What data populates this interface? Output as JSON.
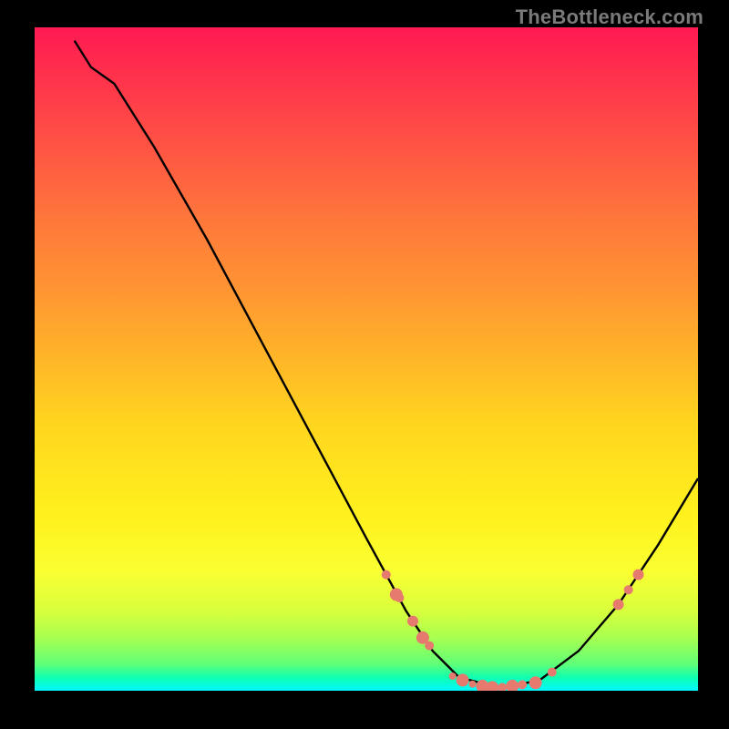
{
  "watermark": "TheBottleneck.com",
  "chart_data": {
    "type": "line",
    "title": "",
    "xlabel": "",
    "ylabel": "",
    "xlim": [
      0,
      100
    ],
    "ylim": [
      0,
      100
    ],
    "curve": {
      "name": "bottleneck-curve",
      "color": "#000000",
      "points": [
        {
          "x": 6.0,
          "y": 98.0
        },
        {
          "x": 8.5,
          "y": 94.0
        },
        {
          "x": 12.0,
          "y": 91.5
        },
        {
          "x": 18.0,
          "y": 82.0
        },
        {
          "x": 26.0,
          "y": 68.0
        },
        {
          "x": 34.0,
          "y": 53.0
        },
        {
          "x": 42.0,
          "y": 38.0
        },
        {
          "x": 50.0,
          "y": 23.0
        },
        {
          "x": 56.0,
          "y": 12.0
        },
        {
          "x": 60.0,
          "y": 6.0
        },
        {
          "x": 64.0,
          "y": 2.0
        },
        {
          "x": 70.0,
          "y": 0.5
        },
        {
          "x": 76.0,
          "y": 1.5
        },
        {
          "x": 82.0,
          "y": 6.0
        },
        {
          "x": 88.0,
          "y": 13.0
        },
        {
          "x": 94.0,
          "y": 22.0
        },
        {
          "x": 100.0,
          "y": 32.0
        }
      ]
    },
    "markers": {
      "color": "#e77a6f",
      "points": [
        {
          "x": 53.0,
          "y": 17.5,
          "r": 5
        },
        {
          "x": 54.5,
          "y": 14.5,
          "r": 7
        },
        {
          "x": 55.0,
          "y": 14.0,
          "r": 5
        },
        {
          "x": 57.0,
          "y": 10.5,
          "r": 6
        },
        {
          "x": 58.5,
          "y": 8.0,
          "r": 7
        },
        {
          "x": 59.5,
          "y": 6.8,
          "r": 5
        },
        {
          "x": 63.0,
          "y": 2.2,
          "r": 4
        },
        {
          "x": 64.5,
          "y": 1.6,
          "r": 7
        },
        {
          "x": 66.0,
          "y": 1.0,
          "r": 4
        },
        {
          "x": 67.5,
          "y": 0.7,
          "r": 7
        },
        {
          "x": 69.0,
          "y": 0.5,
          "r": 7
        },
        {
          "x": 70.5,
          "y": 0.5,
          "r": 5
        },
        {
          "x": 72.0,
          "y": 0.7,
          "r": 7
        },
        {
          "x": 73.5,
          "y": 0.9,
          "r": 5
        },
        {
          "x": 75.5,
          "y": 1.2,
          "r": 7
        },
        {
          "x": 78.0,
          "y": 2.8,
          "r": 5
        },
        {
          "x": 88.0,
          "y": 13.0,
          "r": 6
        },
        {
          "x": 89.5,
          "y": 15.2,
          "r": 5
        },
        {
          "x": 91.0,
          "y": 17.5,
          "r": 6
        }
      ]
    }
  }
}
